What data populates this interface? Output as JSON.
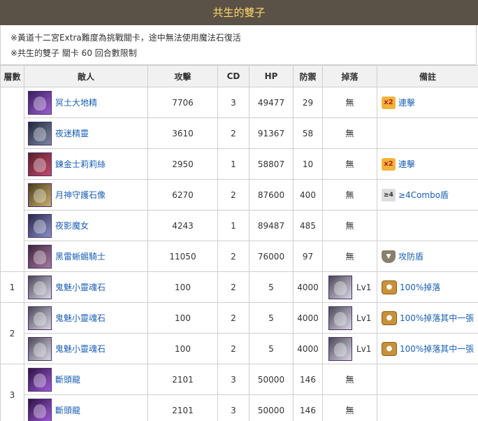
{
  "title": "共生的雙子",
  "notes": [
    "※黃道十二宮Extra難度為挑戰關卡，途中無法使用魔法石復活",
    "※共生的雙子 關卡 60 回合數限制"
  ],
  "headers": [
    "層數",
    "敵人",
    "攻擊",
    "CD",
    "HP",
    "防禦",
    "掉落",
    "備註"
  ],
  "none_text": "無",
  "rows": [
    {
      "floor": "",
      "name": "冥土大地精",
      "atk": "7706",
      "cd": "3",
      "hp": "49477",
      "def": "29",
      "drop": "無",
      "note": "連擊",
      "note_icon": "combo-x2-icon",
      "note_badge": "x2",
      "avatar": "av-purple"
    },
    {
      "floor": "",
      "name": "夜迷精靈",
      "atk": "3610",
      "cd": "2",
      "hp": "91367",
      "def": "58",
      "drop": "無",
      "note": "",
      "note_icon": "",
      "note_badge": "",
      "avatar": "av-dark"
    },
    {
      "floor": "",
      "name": "鍊金士莉莉絲",
      "atk": "2950",
      "cd": "1",
      "hp": "58807",
      "def": "10",
      "drop": "無",
      "note": "連擊",
      "note_icon": "combo-x2-icon",
      "note_badge": "x2",
      "avatar": "av-red"
    },
    {
      "floor": "",
      "name": "月神守護石像",
      "atk": "6270",
      "cd": "2",
      "hp": "87600",
      "def": "400",
      "drop": "無",
      "note": "≥4Combo盾",
      "note_icon": "combo-shield-icon",
      "note_badge": "≥4",
      "avatar": "av-gold"
    },
    {
      "floor": "",
      "name": "夜影魔女",
      "atk": "4243",
      "cd": "1",
      "hp": "89487",
      "def": "485",
      "drop": "無",
      "note": "",
      "note_icon": "",
      "note_badge": "",
      "avatar": "av-blue"
    },
    {
      "floor": "",
      "name": "黑雷蜥蜴騎士",
      "atk": "11050",
      "cd": "2",
      "hp": "76000",
      "def": "97",
      "drop": "無",
      "note": "攻防盾",
      "note_icon": "shield-icon",
      "note_badge": "",
      "avatar": "av-rose"
    },
    {
      "floor": "1",
      "name": "鬼魅小靈魂石",
      "atk": "100",
      "cd": "2",
      "hp": "5",
      "def": "4000",
      "drop": "Lv1",
      "note": "100%掉落",
      "note_icon": "drop-icon",
      "note_badge": "",
      "avatar": "av-ghost"
    },
    {
      "floor": "2",
      "name": "鬼魅小靈魂石",
      "atk": "100",
      "cd": "2",
      "hp": "5",
      "def": "4000",
      "drop": "Lv1",
      "note": "100%掉落其中一張",
      "note_icon": "drop-icon",
      "note_badge": "",
      "avatar": "av-ghost"
    },
    {
      "floor": "",
      "name": "鬼魅小靈魂石",
      "atk": "100",
      "cd": "2",
      "hp": "5",
      "def": "4000",
      "drop": "Lv1",
      "note": "100%掉落其中一張",
      "note_icon": "drop-icon",
      "note_badge": "",
      "avatar": "av-ghost"
    },
    {
      "floor": "3",
      "name": "斷頭龍",
      "atk": "2101",
      "cd": "3",
      "hp": "50000",
      "def": "146",
      "drop": "無",
      "note": "",
      "note_icon": "",
      "note_badge": "",
      "avatar": "av-dragon"
    },
    {
      "floor": "",
      "name": "斷頭龍",
      "atk": "2101",
      "cd": "3",
      "hp": "50000",
      "def": "146",
      "drop": "無",
      "note": "",
      "note_icon": "",
      "note_badge": "",
      "avatar": "av-dragon"
    }
  ]
}
